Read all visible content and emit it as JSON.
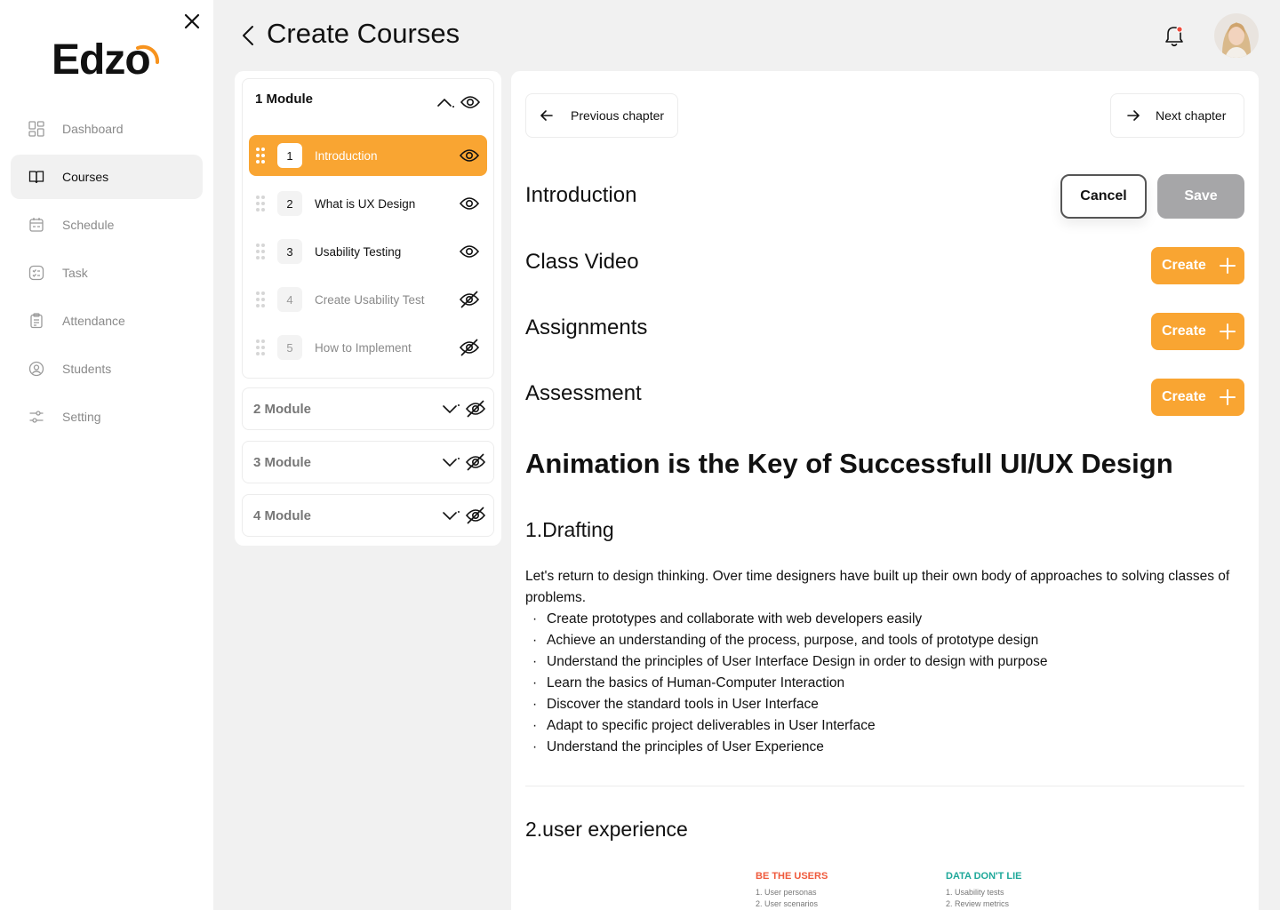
{
  "sidebar": {
    "logo": "Edzo",
    "nav": [
      {
        "label": "Dashboard",
        "icon": "grid-icon"
      },
      {
        "label": "Courses",
        "icon": "book-icon",
        "active": true
      },
      {
        "label": "Schedule",
        "icon": "calendar-icon"
      },
      {
        "label": "Task",
        "icon": "task-list-icon"
      },
      {
        "label": "Attendance",
        "icon": "clipboard-icon"
      },
      {
        "label": "Students",
        "icon": "user-circle-icon"
      },
      {
        "label": "Setting",
        "icon": "sliders-icon"
      }
    ]
  },
  "header": {
    "title": "Create Courses"
  },
  "modules": {
    "open": {
      "title": "1 Module",
      "lessons": [
        {
          "num": "1",
          "title": "Introduction",
          "active": true,
          "visible": true
        },
        {
          "num": "2",
          "title": "What is UX Design",
          "visible": true
        },
        {
          "num": "3",
          "title": "Usability Testing",
          "visible": true
        },
        {
          "num": "4",
          "title": "Create Usability Test",
          "visible": false
        },
        {
          "num": "5",
          "title": "How to Implement",
          "visible": false
        }
      ]
    },
    "closed": [
      {
        "title": "2 Module"
      },
      {
        "title": "3 Module"
      },
      {
        "title": "4 Module"
      }
    ]
  },
  "content": {
    "prev_label": "Previous chapter",
    "next_label": "Next chapter",
    "chapter_title": "Introduction",
    "cancel_label": "Cancel",
    "save_label": "Save",
    "sections": [
      {
        "title": "Class Video",
        "button": "Create"
      },
      {
        "title": "Assignments",
        "button": "Create"
      },
      {
        "title": "Assessment",
        "button": "Create"
      }
    ],
    "article_title": "Animation is the Key of Successfull UI/UX Design",
    "heading1": "1.Drafting",
    "paragraph": "Let's return to design thinking. Over time designers have built up their own body of approaches to solving classes of problems.",
    "bullets": [
      "Create prototypes and collaborate with web developers easily",
      "Achieve an understanding of the process, purpose, and tools of prototype design",
      "Understand the principles of User Interface Design in order to design with purpose",
      "Learn the basics of Human-Computer Interaction",
      "Discover the standard tools in User Interface",
      "Adapt to specific project deliverables in User Interface",
      "Understand the principles of User Experience"
    ],
    "heading2": "2.user experience",
    "ux_columns": [
      {
        "heading": "BE THE USERS",
        "color": "#ef5a3c",
        "items": [
          "1. User personas",
          "2. User scenarios"
        ]
      },
      {
        "heading": "DATA DON'T LIE",
        "color": "#1fa89a",
        "items": [
          "1. Usability tests",
          "2. Review metrics"
        ]
      }
    ]
  },
  "colors": {
    "accent": "#f9a532",
    "save_disabled": "#a6a6a8",
    "notification_dot": "#ef4b3c"
  }
}
